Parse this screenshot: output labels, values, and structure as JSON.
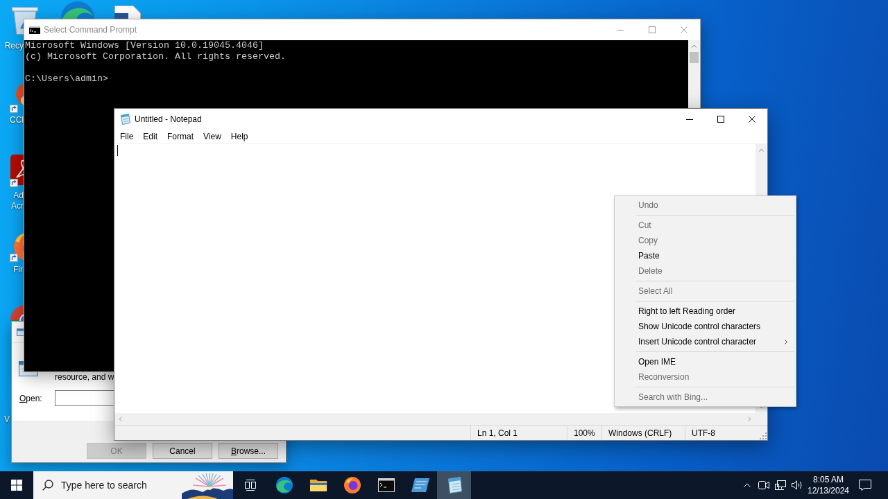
{
  "desktop_icons": [
    {
      "kind": "bin",
      "label_lines": [
        "Recy"
      ]
    },
    {
      "kind": "swirl"
    },
    {
      "kind": "document"
    },
    {
      "kind": "ring",
      "label_lines": [
        "CCl"
      ],
      "shortcut": true
    },
    {
      "kind": "tile",
      "label_lines": [
        "Ad",
        "Acr"
      ],
      "shortcut": true
    },
    {
      "kind": "flame",
      "label_lines": [
        "Fir"
      ],
      "shortcut": true
    },
    {
      "kind": "pinwheel"
    },
    {
      "kind": "obscured",
      "label_lines": [
        "V"
      ]
    }
  ],
  "run_dialog": {
    "description": "resource, and w",
    "open_label": "Open:",
    "buttons": [
      {
        "label": "OK",
        "disabled": true
      },
      {
        "label": "Cancel",
        "disabled": false
      },
      {
        "label": "Browse...",
        "disabled": false
      }
    ]
  },
  "command_prompt": {
    "title": "Select Command Prompt",
    "active": false,
    "output": [
      "Microsoft Windows [Version 10.0.19045.4046]",
      "(c) Microsoft Corporation. All rights reserved."
    ],
    "prompt": "C:\\Users\\admin>"
  },
  "notepad": {
    "title": "Untitled - Notepad",
    "active": true,
    "menu": [
      "File",
      "Edit",
      "Format",
      "View",
      "Help"
    ],
    "status_bar": [
      "Ln 1, Col 1",
      "100%",
      "Windows (CRLF)",
      "UTF-8"
    ]
  },
  "context_menu": {
    "groups": [
      [
        {
          "label": "Undo",
          "disabled": true,
          "submenu": false
        }
      ],
      [
        {
          "label": "Cut",
          "disabled": true,
          "submenu": false
        },
        {
          "label": "Copy",
          "disabled": true,
          "submenu": false
        },
        {
          "label": "Paste",
          "disabled": false,
          "submenu": false
        },
        {
          "label": "Delete",
          "disabled": true,
          "submenu": false
        }
      ],
      [
        {
          "label": "Select All",
          "disabled": true,
          "submenu": false
        }
      ],
      [
        {
          "label": "Right to left Reading order",
          "disabled": false,
          "submenu": false
        },
        {
          "label": "Show Unicode control characters",
          "disabled": false,
          "submenu": false
        },
        {
          "label": "Insert Unicode control character",
          "disabled": false,
          "submenu": true
        }
      ],
      [
        {
          "label": "Open IME",
          "disabled": false,
          "submenu": false
        },
        {
          "label": "Reconversion",
          "disabled": true,
          "submenu": false
        }
      ],
      [
        {
          "label": "Search with Bing...",
          "disabled": true,
          "submenu": false
        }
      ]
    ]
  },
  "taskbar": {
    "search": {
      "placeholder": "Type here to search"
    },
    "apps": [
      {
        "kind": "taskview",
        "selected": false
      },
      {
        "kind": "swirl",
        "selected": false
      },
      {
        "kind": "folder",
        "selected": false
      },
      {
        "kind": "flame",
        "selected": false
      },
      {
        "kind": "console",
        "selected": false
      },
      {
        "kind": "window",
        "selected": false
      },
      {
        "kind": "notepad",
        "selected": true
      }
    ],
    "clock": {
      "time": "8:05 AM",
      "date": "12/13/2024"
    }
  }
}
